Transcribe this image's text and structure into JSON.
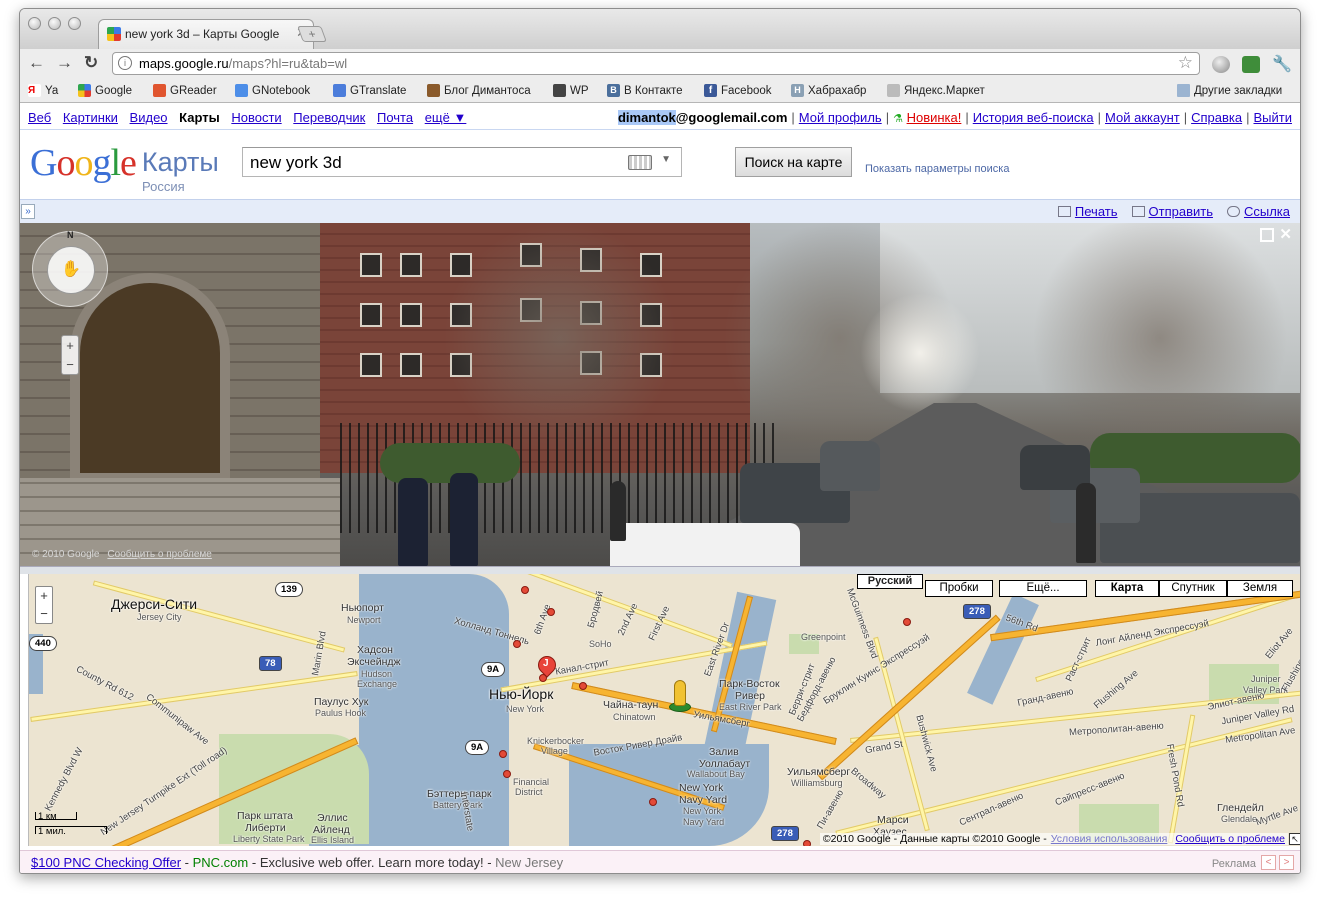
{
  "browser": {
    "tab_title": "new york 3d – Карты Google",
    "url_host": "maps.google.ru",
    "url_path": "/maps?hl=ru&tab=wl",
    "bookmarks": [
      "Ya",
      "Google",
      "GReader",
      "GNotebook",
      "GTranslate",
      "Блог Димантоса",
      "WP",
      "В Контакте",
      "Facebook",
      "Хабрахабр",
      "Яндекс.Маркет"
    ],
    "other_bookmarks": "Другие закладки"
  },
  "gbar": {
    "left": [
      "Веб",
      "Картинки",
      "Видео"
    ],
    "current": "Карты",
    "left_more": [
      "Новости",
      "Переводчик",
      "Почта"
    ],
    "more": "ещё ▼",
    "email_user": "dimantok",
    "email_domain": "@googlemail.com",
    "profile": "Мой профиль",
    "new": "Новинка!",
    "history": "История веб-поиска",
    "account": "Мой аккаунт",
    "help": "Справка",
    "logout": "Выйти"
  },
  "header": {
    "logo_maps": "Карты",
    "logo_country": "Россия",
    "search_value": "new york 3d",
    "search_button": "Поиск на карте",
    "search_options": "Показать параметры поиска"
  },
  "actions": {
    "collapse": "»",
    "print": "Печать",
    "send": "Отправить",
    "link": "Ссылка"
  },
  "streetview": {
    "copyright": "© 2010 Google",
    "report": "Сообщить о проблеме",
    "north": "N"
  },
  "map": {
    "lang": "Русский",
    "traffic": "Пробки",
    "more": "Ещё...",
    "map_type": "Карта",
    "satellite": "Спутник",
    "earth": "Земля",
    "scale_km": "1 км",
    "scale_mi": "1 мил.",
    "copyright": "©2010 Google - Данные карты ©2010 Google -",
    "terms": "Условия использования",
    "report": "Сообщить о проблеме",
    "labels": {
      "jersey_city": "Джерси-Сити",
      "jersey_city_en": "Jersey City",
      "newport": "Ньюпорт",
      "newport_en": "Newport",
      "hudson": "Хадсон",
      "hudson_exchange": "Эксчейндж",
      "hudson_en": "Hudson",
      "hudson_exchange_en": "Exchange",
      "paulus_hook": "Паулус Хук",
      "paulus_hook_en": "Paulus Hook",
      "new_york": "Нью-Йорк",
      "new_york_en": "New York",
      "chinatown": "Чайна-таун",
      "chinatown_en": "Chinatown",
      "soho": "SoHo",
      "knickerbocker": "Knickerbocker",
      "village": "Village",
      "financial": "Financial",
      "district": "District",
      "battery_park": "Бэттери-парк",
      "battery_park_en": "Battery Park",
      "liberty_park": "Парк штата",
      "liberty_park2": "Либерти",
      "liberty_park_en": "Liberty State Park",
      "ellis": "Эллис",
      "ellis2": "Айленд",
      "ellis_en": "Ellis Island",
      "east_village": "Парк-Восток",
      "east_village2": "Ривер",
      "east_river_park": "East River Park",
      "williamsburg": "Уильямсберг",
      "williamsburg_en": "Williamsburg",
      "wallabout": "Залив",
      "wallabout2": "Уоллабаут",
      "wallabout_en": "Wallabout Bay",
      "navy_yard": "New York",
      "navy_yard2": "Navy Yard",
      "greenpoint": "Greenpoint",
      "marcy": "Марси",
      "houses": "Хаузес",
      "glendale": "Глендейл",
      "glendale_en": "Glendale",
      "juniper": "Juniper",
      "juniper2": "Valley Park",
      "juniper_valley": "Juniper Valley Rd",
      "metropolitan_ave": "Metropolitan Ave",
      "grand_st": "Grand St",
      "broadway": "Broadway",
      "bushwick": "Bushwick Ave",
      "myrtle": "Myrtle Ave",
      "flushing": "Flushing Ave",
      "grand_ave": "Гранд-авеню",
      "metropolitan_ru": "Метрополитан-авеню",
      "elliot": "Элиот-авеню",
      "cypress": "Сайпресс-авеню",
      "central": "Сентрал-авеню",
      "fresh_pond": "Fresh Pond Rd",
      "long_island": "Лонг Айленд Экспрессуэй",
      "bqe": "Бруклин Куинс Экспрессуэй",
      "fdr": "Восток Ривер Драйв",
      "holland": "Холланд Тоннель",
      "williamsburg_bridge": "Уильямсберг",
      "communipaw": "Communipaw Ave",
      "county": "County Rd 612",
      "nj_turnpike": "New Jersey Turnpike Ext (Toll road)",
      "kennedy": "Kennedy Blvd W",
      "marin": "Marin Blvd",
      "ave_6": "6th Ave",
      "broadway_m": "Бродвей",
      "ave_2": "2nd Ave",
      "first_ave": "First Ave",
      "east_river_dr": "East River Dr",
      "canal": "Канал-стрит",
      "mcguinness": "McGuinness Blvd",
      "berry": "Берри-стрит",
      "bedford": "Бедфорд-авеню",
      "fifty_sixth": "56th Rd",
      "rust": "Раст-стрит",
      "interstate": "Interstate",
      "pia": "Пи-авеню",
      "eliot_ave": "Eliot Ave",
      "flushing_ave": "Flushing Ave"
    },
    "shields": [
      "139",
      "440",
      "78",
      "9A",
      "9A",
      "278",
      "278"
    ]
  },
  "ad": {
    "title": "$100 PNC Checking Offer",
    "url": "PNC.com",
    "text": "Exclusive web offer. Learn more today!",
    "location": "New Jersey",
    "label": "Реклама"
  }
}
